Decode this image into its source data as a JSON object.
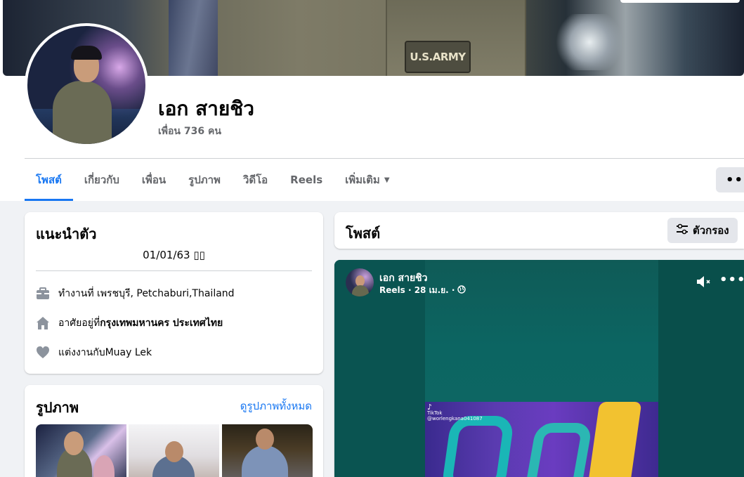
{
  "profile": {
    "name": "เอก สายชิว",
    "friends": "เพื่อน 736 คน",
    "cover_patch_text": "U.S.ARMY"
  },
  "tabs": [
    {
      "label": "โพสต์",
      "active": true
    },
    {
      "label": "เกี่ยวกับ",
      "active": false
    },
    {
      "label": "เพื่อน",
      "active": false
    },
    {
      "label": "รูปภาพ",
      "active": false
    },
    {
      "label": "วิดีโอ",
      "active": false
    },
    {
      "label": "Reels",
      "active": false
    },
    {
      "label": "เพิ่มเติม",
      "active": false
    }
  ],
  "more_button": "•••",
  "intro": {
    "title": "แนะนำตัว",
    "bio": "01/01/63 ",
    "work": {
      "prefix": "ทำงานที่ เพรชบุรี, Petchaburi,Thailand",
      "bold": ""
    },
    "lives": {
      "prefix": "อาศัยอยู่ที่ ",
      "bold": "กรุงเทพมหานคร ประเทศไทย"
    },
    "relationship": {
      "prefix": "แต่งงานกับ ",
      "bold": "Muay Lek"
    }
  },
  "photos": {
    "title": "รูปภาพ",
    "see_all": "ดูรูปภาพทั้งหมด"
  },
  "posts": {
    "title": "โพสต์",
    "filter_label": "ตัวกรอง"
  },
  "reel_post": {
    "author": "เอก สายชิว",
    "meta": "Reels · 28 เม.ย. ·",
    "tiktok_label": "TikTok",
    "tiktok_handle": "@worlengkana041087"
  },
  "colors": {
    "accent": "#1877f2",
    "page_bg": "#f0f2f5",
    "reel_bg": "#0a5450"
  }
}
